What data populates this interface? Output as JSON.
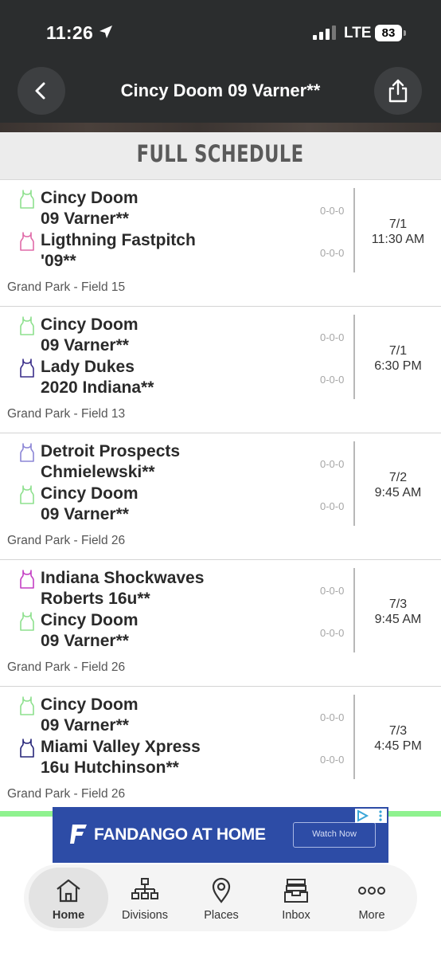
{
  "status_bar": {
    "time": "11:26",
    "network": "LTE",
    "battery": "83"
  },
  "header": {
    "title": "Cincy Doom 09 Varner**"
  },
  "schedule": {
    "heading": "FULL SCHEDULE",
    "games": [
      {
        "team1": {
          "name_line1": "Cincy Doom",
          "name_line2": "09 Varner**",
          "record": "0-0-0",
          "jersey_color": "#8ee08e"
        },
        "team2": {
          "name_line1": "Ligthning Fastpitch",
          "name_line2": "'09**",
          "record": "0-0-0",
          "jersey_color": "#e06aa8"
        },
        "date": "7/1",
        "time": "11:30 AM",
        "venue": "Grand Park - Field 15"
      },
      {
        "team1": {
          "name_line1": "Cincy Doom",
          "name_line2": "09 Varner**",
          "record": "0-0-0",
          "jersey_color": "#8ee08e"
        },
        "team2": {
          "name_line1": "Lady Dukes",
          "name_line2": "2020 Indiana**",
          "record": "0-0-0",
          "jersey_color": "#3a2e8a"
        },
        "date": "7/1",
        "time": "6:30 PM",
        "venue": "Grand Park - Field 13"
      },
      {
        "team1": {
          "name_line1": "Detroit Prospects",
          "name_line2": "Chmielewski**",
          "record": "0-0-0",
          "jersey_color": "#8c86d6"
        },
        "team2": {
          "name_line1": "Cincy Doom",
          "name_line2": "09 Varner**",
          "record": "0-0-0",
          "jersey_color": "#8ee08e"
        },
        "date": "7/2",
        "time": "9:45 AM",
        "venue": "Grand Park - Field 26"
      },
      {
        "team1": {
          "name_line1": "Indiana Shockwaves",
          "name_line2": "Roberts 16u**",
          "record": "0-0-0",
          "jersey_color": "#c43fc4"
        },
        "team2": {
          "name_line1": "Cincy Doom",
          "name_line2": "09 Varner**",
          "record": "0-0-0",
          "jersey_color": "#8ee08e"
        },
        "date": "7/3",
        "time": "9:45 AM",
        "venue": "Grand Park - Field 26"
      },
      {
        "team1": {
          "name_line1": "Cincy Doom",
          "name_line2": "09 Varner**",
          "record": "0-0-0",
          "jersey_color": "#8ee08e"
        },
        "team2": {
          "name_line1": "Miami Valley Xpress",
          "name_line2": "16u Hutchinson**",
          "record": "0-0-0",
          "jersey_color": "#27267a"
        },
        "date": "7/3",
        "time": "4:45 PM",
        "venue": "Grand Park - Field 26"
      }
    ]
  },
  "ad": {
    "brand": "FANDANGO AT HOME",
    "button": "Watch Now"
  },
  "tabs": [
    {
      "label": "Home",
      "icon": "home-icon"
    },
    {
      "label": "Divisions",
      "icon": "org-chart-icon"
    },
    {
      "label": "Places",
      "icon": "location-pin-icon"
    },
    {
      "label": "Inbox",
      "icon": "inbox-tray-icon"
    },
    {
      "label": "More",
      "icon": "more-dots-icon"
    }
  ]
}
